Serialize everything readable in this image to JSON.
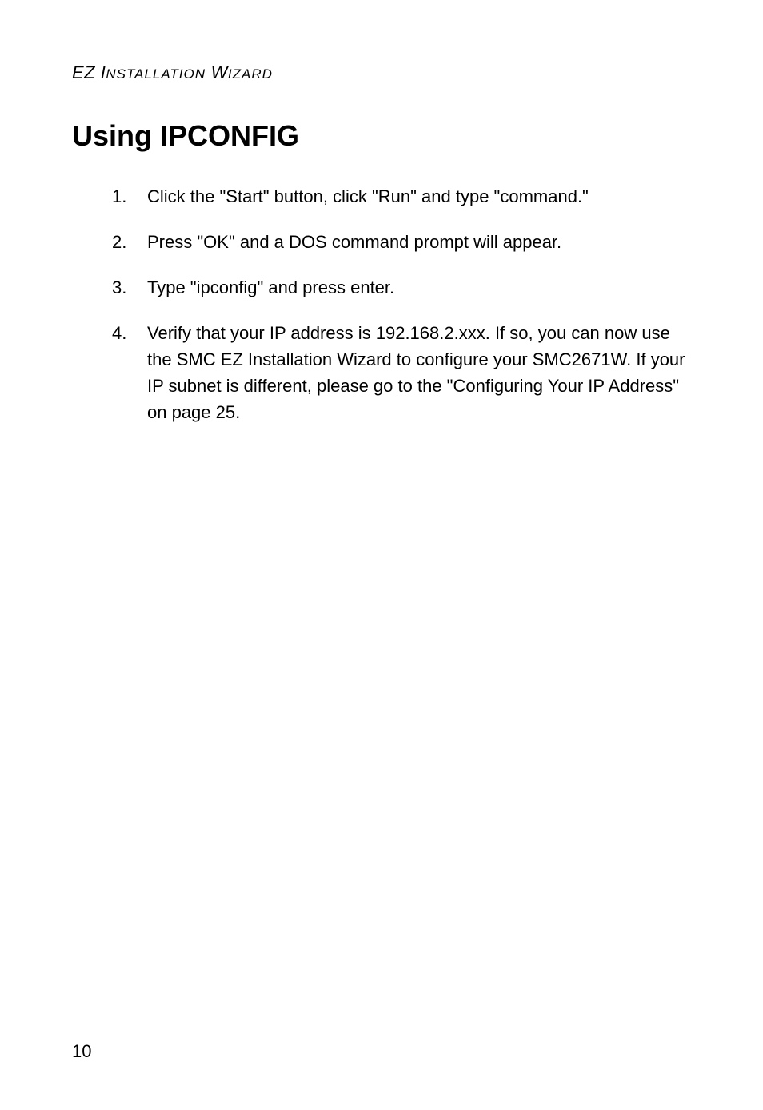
{
  "header": {
    "prefix": "EZ I",
    "middle": "NSTALLATION",
    "space": " W",
    "suffix": "IZARD"
  },
  "title": "Using IPCONFIG",
  "steps": [
    {
      "number": "1.",
      "text": "Click the \"Start\" button, click \"Run\" and type \"command.\""
    },
    {
      "number": "2.",
      "text": "Press \"OK\" and a DOS command prompt will appear."
    },
    {
      "number": "3.",
      "text": "Type \"ipconfig\" and press enter."
    },
    {
      "number": "4.",
      "text": "Verify that your IP address is 192.168.2.xxx. If so, you can now use the SMC EZ Installation Wizard to configure your SMC2671W. If your IP subnet is different, please go to the \"Configuring Your IP Address\" on page 25."
    }
  ],
  "pageNumber": "10"
}
